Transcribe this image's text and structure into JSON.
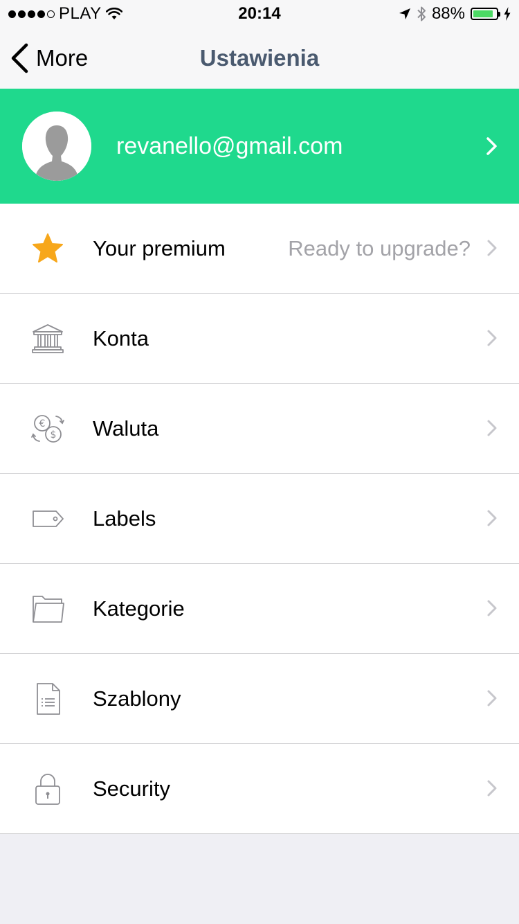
{
  "status_bar": {
    "carrier": "PLAY",
    "time": "20:14",
    "battery": "88%",
    "battery_level": 0.88,
    "signal_bars": 4,
    "signal_total": 5
  },
  "nav": {
    "back_label": "More",
    "title": "Ustawienia"
  },
  "profile": {
    "email": "revanello@gmail.com"
  },
  "settings": {
    "premium": {
      "label": "Your premium",
      "value": "Ready to upgrade?",
      "icon": "star-icon"
    },
    "konta": {
      "label": "Konta",
      "icon": "bank-icon"
    },
    "waluta": {
      "label": "Waluta",
      "icon": "currency-exchange-icon"
    },
    "labels": {
      "label": "Labels",
      "icon": "tag-icon"
    },
    "kategorie": {
      "label": "Kategorie",
      "icon": "folder-icon"
    },
    "szablony": {
      "label": "Szablony",
      "icon": "document-icon"
    },
    "security": {
      "label": "Security",
      "icon": "lock-icon"
    }
  },
  "colors": {
    "accent_green": "#1fd98d",
    "nav_title": "#4a5a6f",
    "star": "#f7a71b",
    "chevron": "#c7c7cc",
    "secondary_text": "#a3a3a8"
  }
}
